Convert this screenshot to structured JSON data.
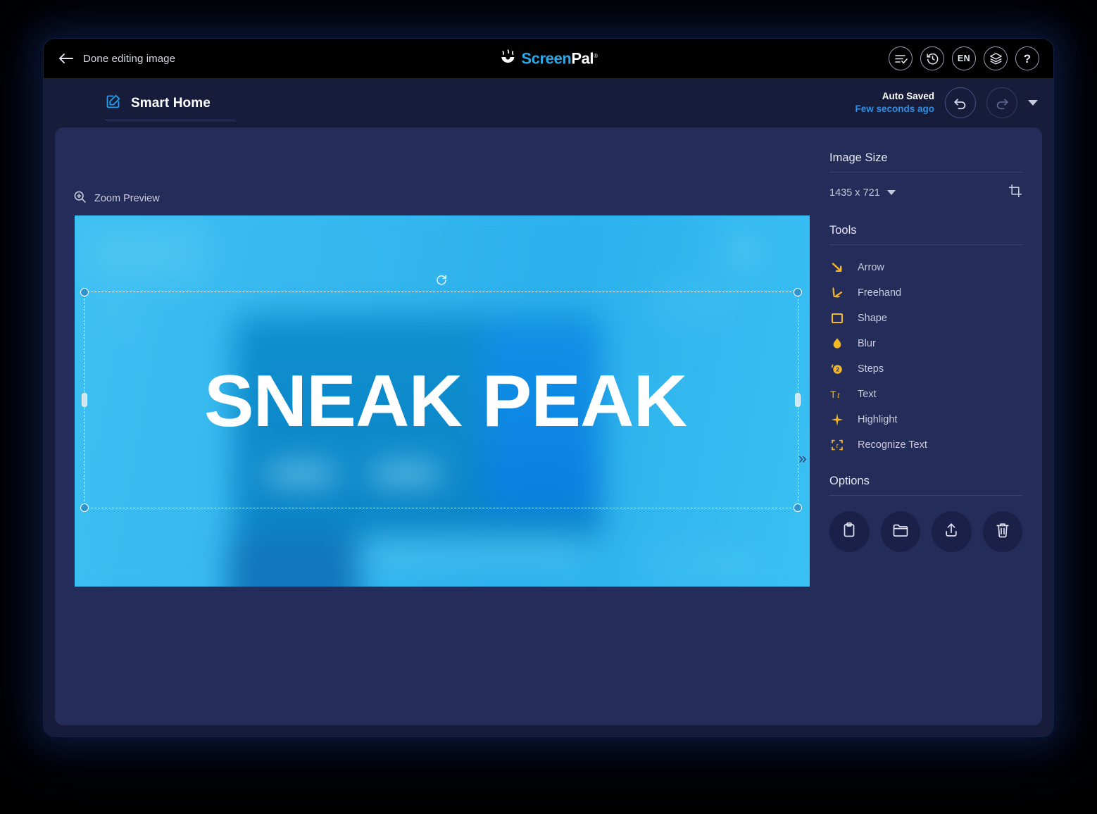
{
  "titlebar": {
    "back_label": "Done editing image",
    "back_icon": "arrow-left-icon",
    "brand": {
      "screen": "Screen",
      "pal": "Pal",
      "registered": "®",
      "mark_icon": "screenpal-logo-icon"
    },
    "actions": [
      {
        "name": "list-check-icon",
        "label": ""
      },
      {
        "name": "history-clock-icon",
        "label": ""
      },
      {
        "name": "language-selector",
        "label": "EN"
      },
      {
        "name": "layers-icon",
        "label": ""
      },
      {
        "name": "help-icon",
        "label": "?"
      }
    ]
  },
  "project": {
    "title": "Smart Home",
    "edit_icon": "edit-pencil-square-icon",
    "autosave_label": "Auto Saved",
    "autosave_time": "Few seconds ago",
    "undo_icon": "undo-icon",
    "redo_icon": "redo-icon",
    "history_caret_icon": "chevron-down-icon"
  },
  "canvas": {
    "zoom_preview_label": "Zoom Preview",
    "zoom_preview_icon": "magnifier-plus-icon",
    "headline": "SNEAK PEAK",
    "collapse_icon": "chevron-double-right-icon",
    "rotate_handle_icon": "rotate-icon"
  },
  "rail": {
    "image_size": {
      "heading": "Image Size",
      "value": "1435 x 721",
      "crop_icon": "crop-icon",
      "caret_icon": "chevron-down-icon"
    },
    "tools": {
      "heading": "Tools",
      "items": [
        {
          "label": "Arrow",
          "icon": "arrow-tool-icon"
        },
        {
          "label": "Freehand",
          "icon": "freehand-tool-icon"
        },
        {
          "label": "Shape",
          "icon": "shape-tool-icon"
        },
        {
          "label": "Blur",
          "icon": "blur-tool-icon"
        },
        {
          "label": "Steps",
          "icon": "steps-tool-icon"
        },
        {
          "label": "Text",
          "icon": "text-tool-icon"
        },
        {
          "label": "Highlight",
          "icon": "highlight-tool-icon"
        },
        {
          "label": "Recognize Text",
          "icon": "recognize-text-tool-icon"
        }
      ]
    },
    "options": {
      "heading": "Options",
      "items": [
        {
          "name": "copy-to-clipboard-button",
          "icon": "clipboard-icon"
        },
        {
          "name": "save-to-folder-button",
          "icon": "folder-icon"
        },
        {
          "name": "upload-share-button",
          "icon": "upload-icon"
        },
        {
          "name": "delete-button",
          "icon": "trash-icon"
        }
      ]
    }
  },
  "colors": {
    "app_bg": "#000000",
    "titlebar_bg": "#000000",
    "chrome_bg": "#161c3a",
    "panel_bg": "#242c5a",
    "accent_blue": "#2f8fe0",
    "brand_blue": "#2aa8e8",
    "tool_amber": "#f5b724",
    "image_blue": "#38bdf1"
  }
}
